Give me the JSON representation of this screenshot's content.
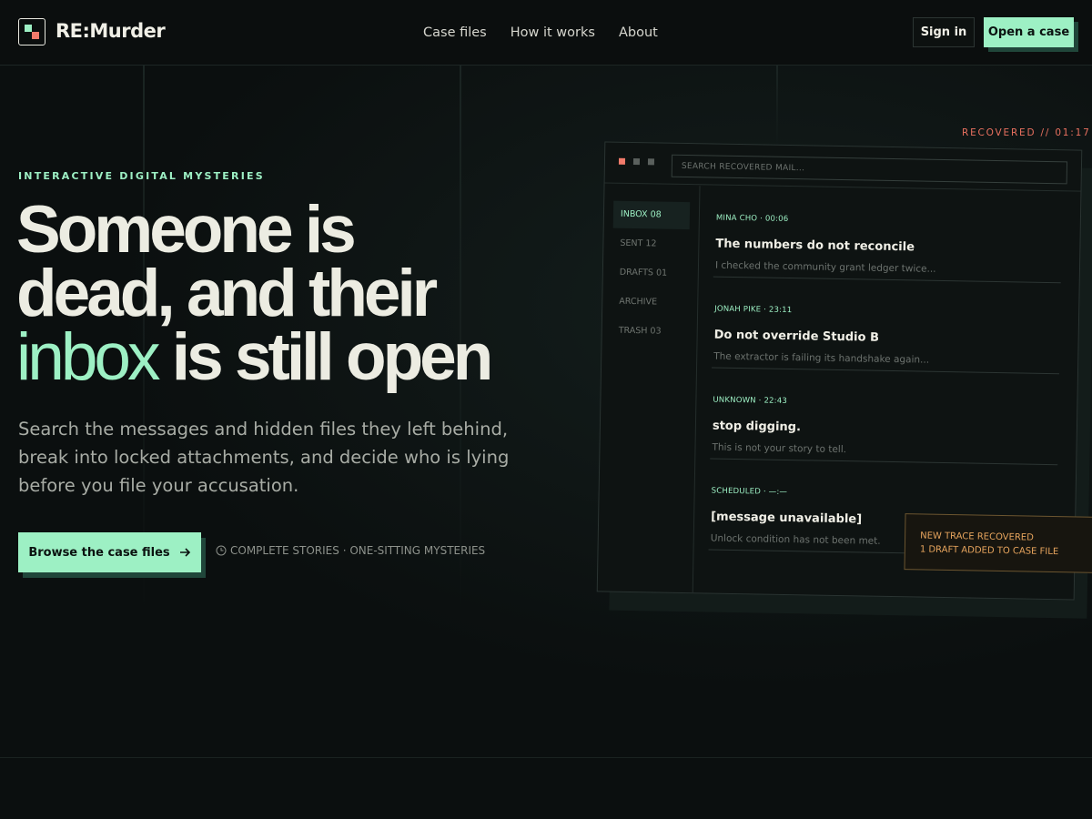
{
  "header": {
    "brand": "RE:Murder",
    "nav": [
      "Case files",
      "How it works",
      "About"
    ],
    "signin_label": "Sign in",
    "open_case_label": "Open a case"
  },
  "hero": {
    "eyebrow": "INTERACTIVE DIGITAL MYSTERIES",
    "headline_line1": "Someone is",
    "headline_line2": "dead, and their",
    "headline_accent": "inbox",
    "headline_line3_rest": " is still open",
    "subtext": "Search the messages and hidden files they left behind, break into locked attachments, and decide who is lying before you file your accusation.",
    "cta_label": "Browse the case files",
    "meta": "COMPLETE STORIES · ONE-SITTING MYSTERIES"
  },
  "mockup": {
    "recovered_label": "RECOVERED // 01:17",
    "search_placeholder": "SEARCH RECOVERED MAIL...",
    "folders": [
      "INBOX 08",
      "SENT 12",
      "DRAFTS 01",
      "ARCHIVE",
      "TRASH 03"
    ],
    "messages": [
      {
        "from": "MINA CHO · 00:06",
        "subject": "The numbers do not reconcile",
        "preview": "I checked the community grant ledger twice..."
      },
      {
        "from": "JONAH PIKE · 23:11",
        "subject": "Do not override Studio B",
        "preview": "The extractor is failing its handshake again..."
      },
      {
        "from": "UNKNOWN · 22:43",
        "subject": "stop digging.",
        "preview": "This is not your story to tell."
      },
      {
        "from": "SCHEDULED · —:—",
        "subject": "[message unavailable]",
        "preview": "Unlock condition has not been met."
      }
    ],
    "trace_line1": "NEW TRACE RECOVERED",
    "trace_line2": "1 DRAFT ADDED TO CASE FILE"
  },
  "colors": {
    "accent": "#9df0c4",
    "alert": "#f27b6b",
    "warning": "#e6a45d",
    "background": "#0b0f0f"
  },
  "icons": [
    "logo-icon",
    "arrow-right-icon",
    "clock-icon"
  ]
}
